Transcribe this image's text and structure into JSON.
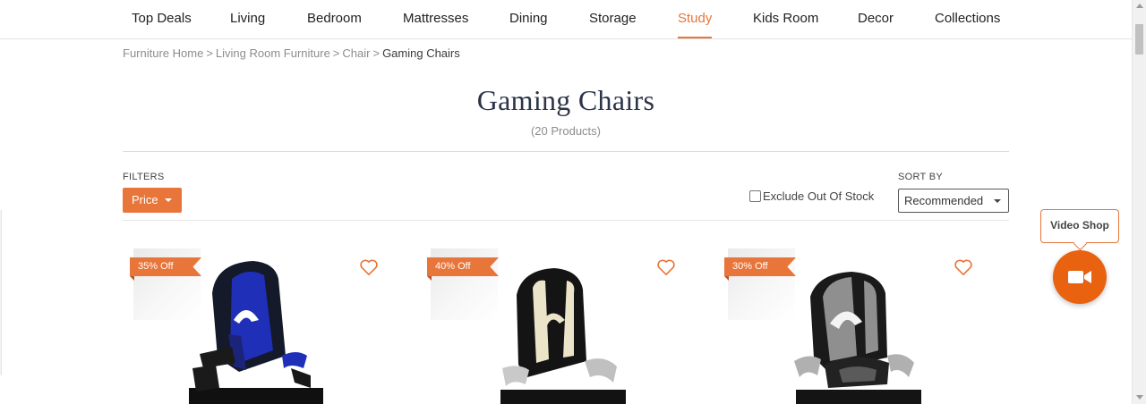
{
  "nav": {
    "items": [
      {
        "label": "Top Deals"
      },
      {
        "label": "Living"
      },
      {
        "label": "Bedroom"
      },
      {
        "label": "Mattresses"
      },
      {
        "label": "Dining"
      },
      {
        "label": "Storage"
      },
      {
        "label": "Study",
        "active": true
      },
      {
        "label": "Kids Room"
      },
      {
        "label": "Decor"
      },
      {
        "label": "Collections"
      }
    ]
  },
  "breadcrumb": {
    "items": [
      "Furniture Home",
      "Living Room Furniture",
      "Chair"
    ],
    "separator": ">",
    "current": "Gaming Chairs"
  },
  "page": {
    "title": "Gaming Chairs",
    "count": "(20 Products)"
  },
  "filters": {
    "label": "FILTERS",
    "price_label": "Price",
    "exclude_label": "Exclude Out Of Stock",
    "exclude_checked": false
  },
  "sort": {
    "label": "SORT BY",
    "selected": "Recommended"
  },
  "products": [
    {
      "discount": "35% Off",
      "accent": "#1f2fb8"
    },
    {
      "discount": "40% Off",
      "accent": "#e8e0c4"
    },
    {
      "discount": "30% Off",
      "accent": "#9b9b9b"
    }
  ],
  "video_shop": {
    "label": "Video Shop"
  },
  "colors": {
    "accent": "#e8753a",
    "title": "#2b3448"
  }
}
